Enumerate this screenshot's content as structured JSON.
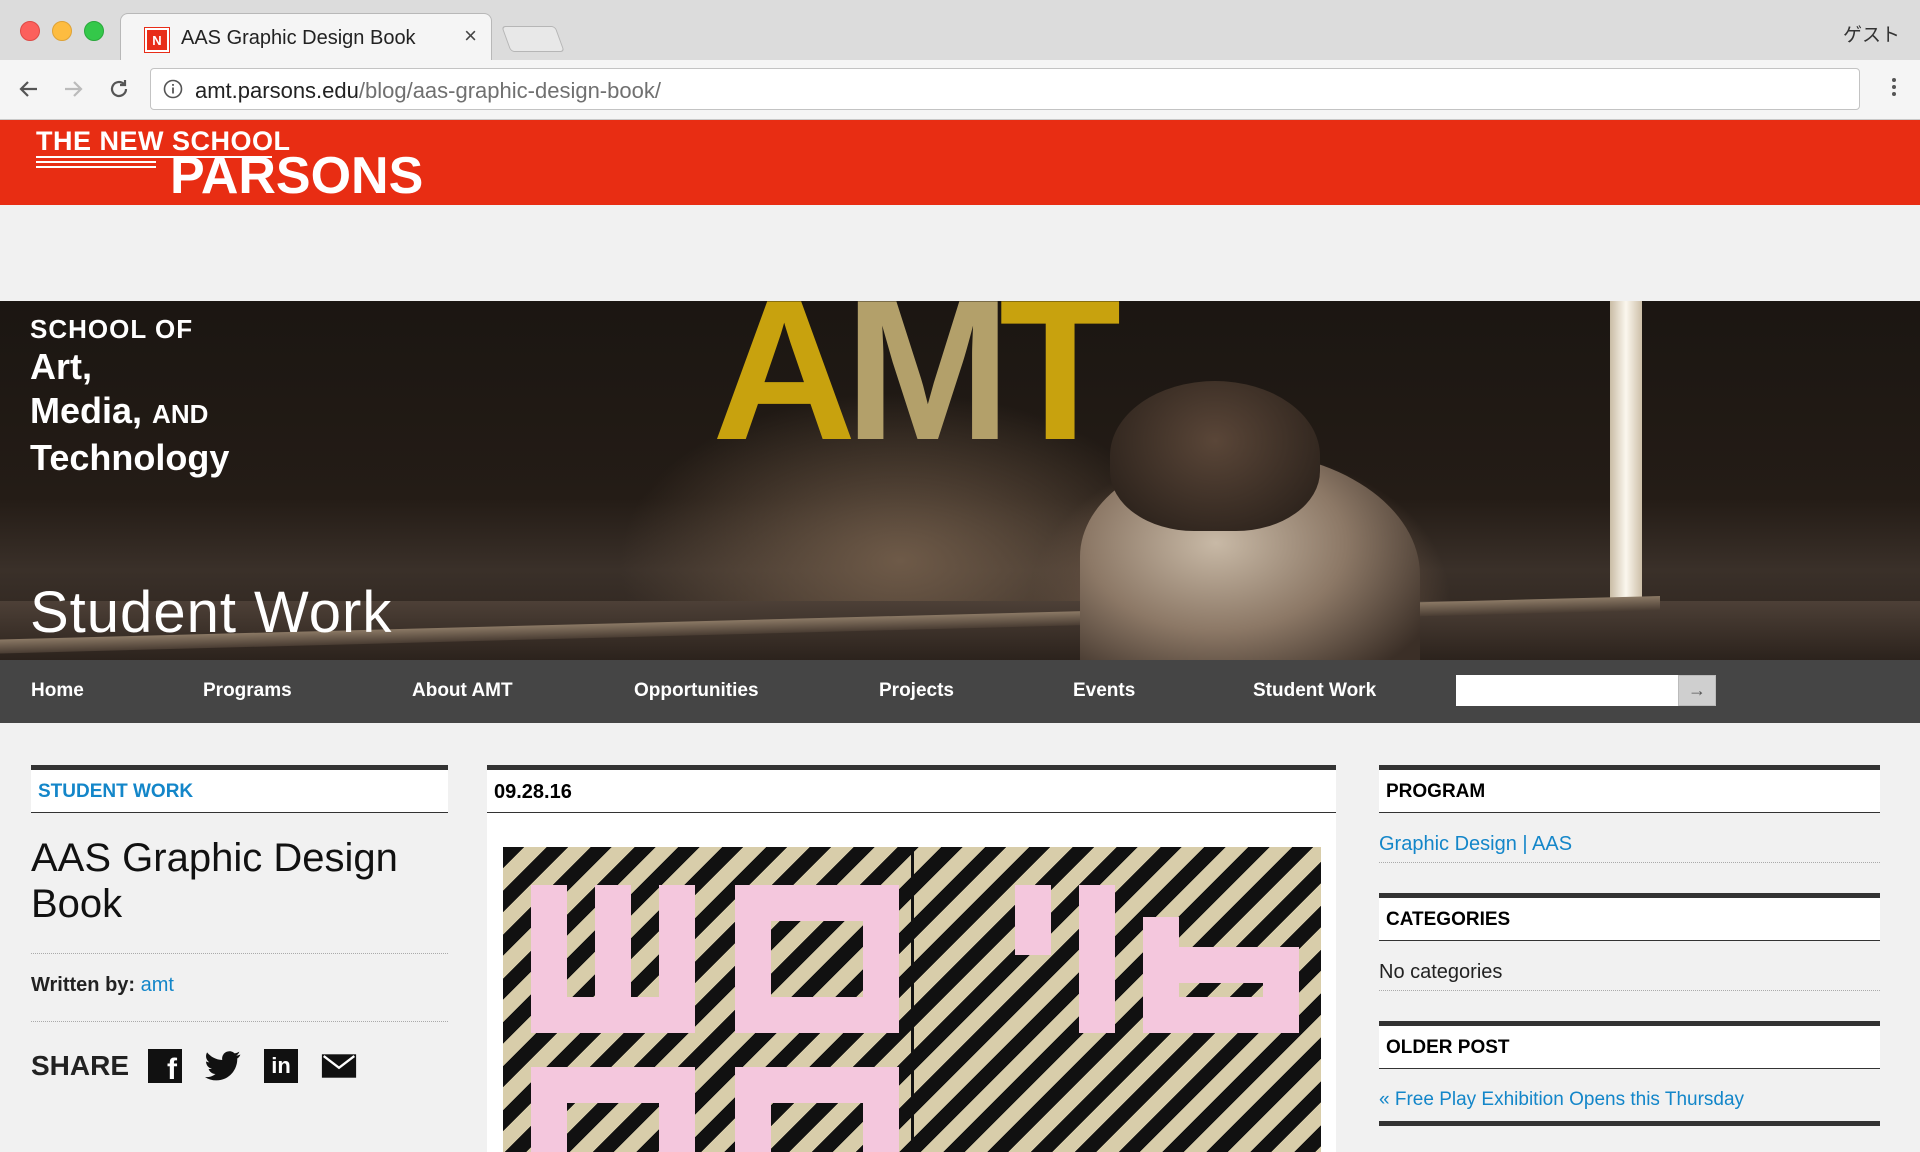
{
  "browser": {
    "tab_title": "AAS Graphic Design Book",
    "tab_favicon_letter": "N",
    "close_glyph": "×",
    "profile_label": "ゲスト",
    "url_host": "amt.parsons.edu",
    "url_path": "/blog/aas-graphic-design-book/"
  },
  "site": {
    "logo_top": "THE NEW SCHOOL",
    "logo_main": "PARSONS",
    "brand_color": "#e82d13"
  },
  "hero": {
    "school_of": "SCHOOL OF",
    "line_art": "Art,",
    "line_media": "Media,",
    "line_and": "AND",
    "line_tech": "Technology",
    "amt_a": "A",
    "amt_m": "M",
    "amt_t": "T",
    "section_title": "Student Work"
  },
  "nav": {
    "items": [
      "Home",
      "Programs",
      "About AMT",
      "Opportunities",
      "Projects",
      "Events",
      "Student Work"
    ],
    "search_placeholder": "",
    "search_button": "→"
  },
  "post": {
    "category": "STUDENT WORK",
    "title": "AAS Graphic Design Book",
    "written_by_label": "Written by:",
    "author": "amt",
    "share_label": "SHARE",
    "share_icons": [
      "facebook-icon",
      "twitter-icon",
      "linkedin-icon",
      "email-icon"
    ],
    "date": "09.28.16"
  },
  "sidebar": {
    "program_heading": "PROGRAM",
    "program_link": "Graphic Design | AAS",
    "categories_heading": "CATEGORIES",
    "categories_text": "No categories",
    "older_heading": "OLDER POST",
    "older_link": "« Free Play Exhibition Opens this Thursday"
  },
  "colors": {
    "link": "#1386c9",
    "nav_bg": "#454545",
    "amt_gold": "#c8a20e",
    "poster_pink": "#f4c7dd"
  }
}
